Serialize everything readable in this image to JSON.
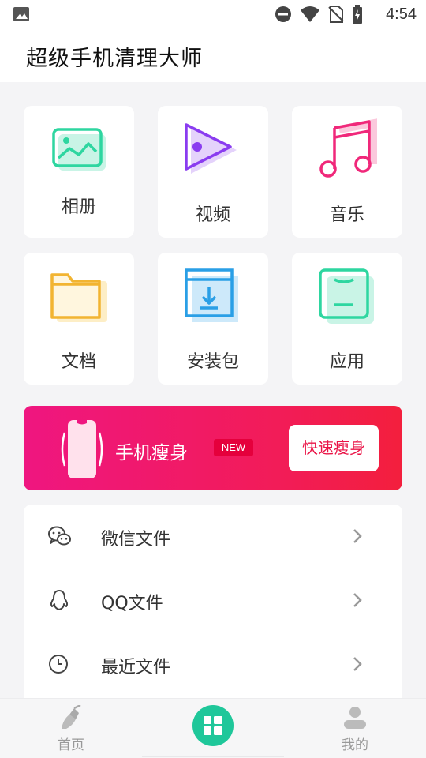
{
  "status_bar": {
    "time": "4:54",
    "icons": [
      "gallery-icon",
      "do-not-disturb-icon",
      "wifi-icon",
      "no-sim-icon",
      "battery-charging-icon"
    ]
  },
  "header": {
    "title": "超级手机清理大师"
  },
  "categories": [
    {
      "label": "相册",
      "icon": "photo-album-icon",
      "color": "#2ed6a0"
    },
    {
      "label": "视频",
      "icon": "video-play-icon",
      "color": "#8a3cf0"
    },
    {
      "label": "音乐",
      "icon": "music-note-icon",
      "color": "#f0287a"
    },
    {
      "label": "文档",
      "icon": "folder-icon",
      "color": "#f2b431"
    },
    {
      "label": "安装包",
      "icon": "package-box-icon",
      "color": "#2a9fe6"
    },
    {
      "label": "应用",
      "icon": "app-box-icon",
      "color": "#2ed6a0"
    }
  ],
  "banner": {
    "title": "手机瘦身",
    "badge": "NEW",
    "button_label": "快速瘦身",
    "colors": {
      "start": "#ef1680",
      "end": "#f31f3d",
      "button_text": "#ea1346"
    }
  },
  "file_list": [
    {
      "label": "微信文件",
      "icon": "wechat-icon"
    },
    {
      "label": "QQ文件",
      "icon": "qq-penguin-icon"
    },
    {
      "label": "最近文件",
      "icon": "clock-icon"
    }
  ],
  "bottom_nav": {
    "items": [
      {
        "label": "首页",
        "icon": "broom-icon"
      },
      {
        "label": "",
        "icon": "grid-apps-icon"
      },
      {
        "label": "我的",
        "icon": "user-profile-icon"
      }
    ],
    "accent": "#1fc79a"
  }
}
